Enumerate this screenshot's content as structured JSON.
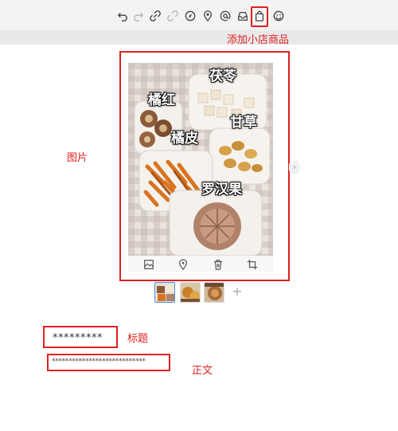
{
  "toolbar": {
    "icons": [
      "undo-icon",
      "redo-icon",
      "link-icon",
      "unlink-icon",
      "compass-icon",
      "location-icon",
      "mention-icon",
      "inbox-icon",
      "shop-bag-icon",
      "emoji-icon"
    ]
  },
  "annotations": {
    "shop_label": "添加小店商品",
    "image_label": "图片",
    "title_label": "标题",
    "body_label": "正文"
  },
  "image": {
    "herb_labels": [
      "茯苓",
      "橘红",
      "甘草",
      "橘皮",
      "罗汉果"
    ],
    "bar_icons": [
      "image-edit-icon",
      "location-icon",
      "delete-icon",
      "crop-icon"
    ],
    "next_arrow": "›"
  },
  "thumbnails": {
    "count": 3,
    "active_index": 0,
    "add_label": "+"
  },
  "post": {
    "title": "*********",
    "body": "****************************"
  },
  "colors": {
    "annotation_red": "#e02020",
    "toolbar_bg": "#f3f3f3"
  }
}
